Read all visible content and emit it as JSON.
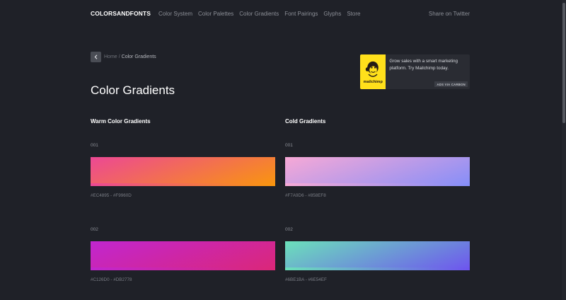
{
  "nav": {
    "brand": "COLORSANDFONTS",
    "links": [
      "Color System",
      "Color Palettes",
      "Color Gradients",
      "Font Pairings",
      "Glyphs",
      "Store"
    ],
    "share": "Share on Twitter"
  },
  "breadcrumb": {
    "home": "Home",
    "separator": "/",
    "current": "Color Gradients"
  },
  "page_title": "Color Gradients",
  "ad": {
    "logo_word": "mailchimp",
    "text": "Grow sales with a smart marketing platform. Try Mailchimp today.",
    "tag": "ADS VIA CARBON"
  },
  "warm": {
    "title": "Warm Color Gradients",
    "items": [
      {
        "num": "001",
        "code": "#EC4895 - #F9960D",
        "from": "#ec4895",
        "to": "#f9960d"
      },
      {
        "num": "002",
        "code": "#C126D0 - #DB2778",
        "from": "#c126d0",
        "to": "#db2778"
      }
    ]
  },
  "cold": {
    "title": "Cold Gradients",
    "items": [
      {
        "num": "001",
        "code": "#F7A9D6 - #858EF8",
        "from": "#f7a9d6",
        "to": "#858ef8"
      },
      {
        "num": "002",
        "code": "#6BE1BA - #6E54EF",
        "from": "#6be1ba",
        "to": "#6e54ef"
      }
    ]
  }
}
